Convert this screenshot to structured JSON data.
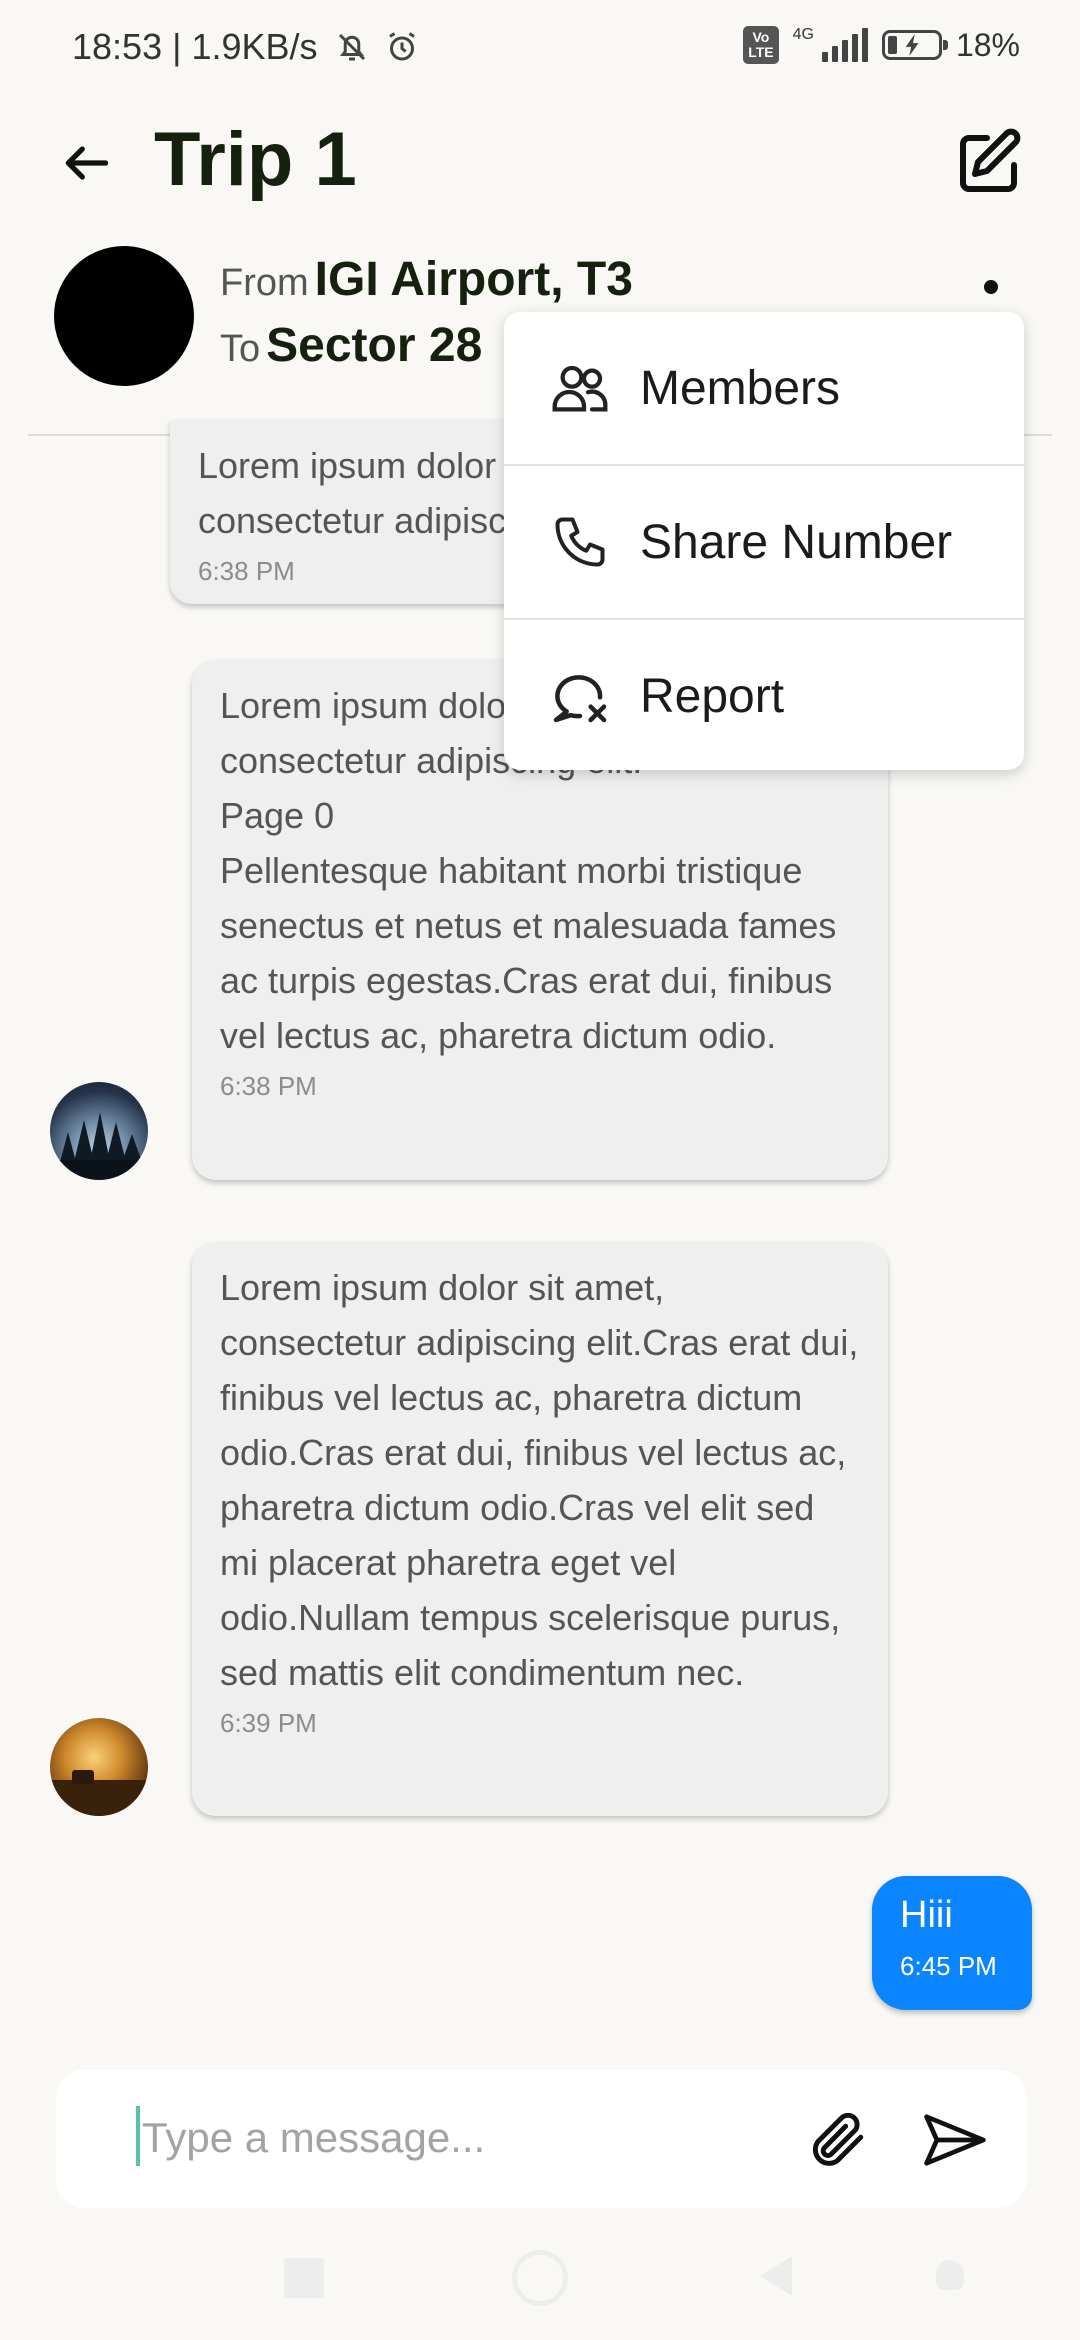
{
  "status_bar": {
    "time": "18:53 | 1.9KB/s",
    "network_label": "4G",
    "volte_label": "Vo LTE",
    "battery": "18%",
    "icons": [
      "mute-bell-icon",
      "alarm-icon",
      "signal-icon",
      "battery-charging-icon"
    ]
  },
  "header": {
    "title": "Trip 1",
    "back_icon": "arrow-left-icon",
    "edit_icon": "edit-square-icon"
  },
  "trip": {
    "from_prefix": "From",
    "from_value": "IGI Airport, T3",
    "to_prefix": "To",
    "to_value": "Sector 28"
  },
  "messages": [
    {
      "text": "Lorem ipsum dolor sit amet,\nconsectetur adipiscing elit.",
      "time": "6:38 PM"
    },
    {
      "text": "Lorem ipsum dolor sit amet,\nconsectetur adipiscing elit.\nPage 0\nPellentesque habitant morbi tristique senectus et netus et malesuada fames ac turpis egestas.Cras erat dui, finibus vel lectus ac, pharetra dictum odio.",
      "time": "6:38 PM"
    },
    {
      "text": "Lorem ipsum dolor sit amet, consectetur adipiscing elit.Cras erat dui, finibus vel lectus ac, pharetra dictum odio.Cras erat dui, finibus vel lectus ac, pharetra dictum odio.Cras vel elit sed mi placerat pharetra eget vel odio.Nullam tempus scelerisque purus, sed mattis elit condimentum nec.",
      "time": "6:39 PM"
    }
  ],
  "my_message": {
    "text": "Hiii",
    "time": "6:45 PM",
    "color": "#0a84ff"
  },
  "composer": {
    "placeholder": "Type a message...",
    "value": ""
  },
  "menu": {
    "items": [
      {
        "label": "Members",
        "icon": "members-icon"
      },
      {
        "label": "Share Number",
        "icon": "phone-icon"
      },
      {
        "label": "Report",
        "icon": "report-chat-icon"
      }
    ]
  }
}
